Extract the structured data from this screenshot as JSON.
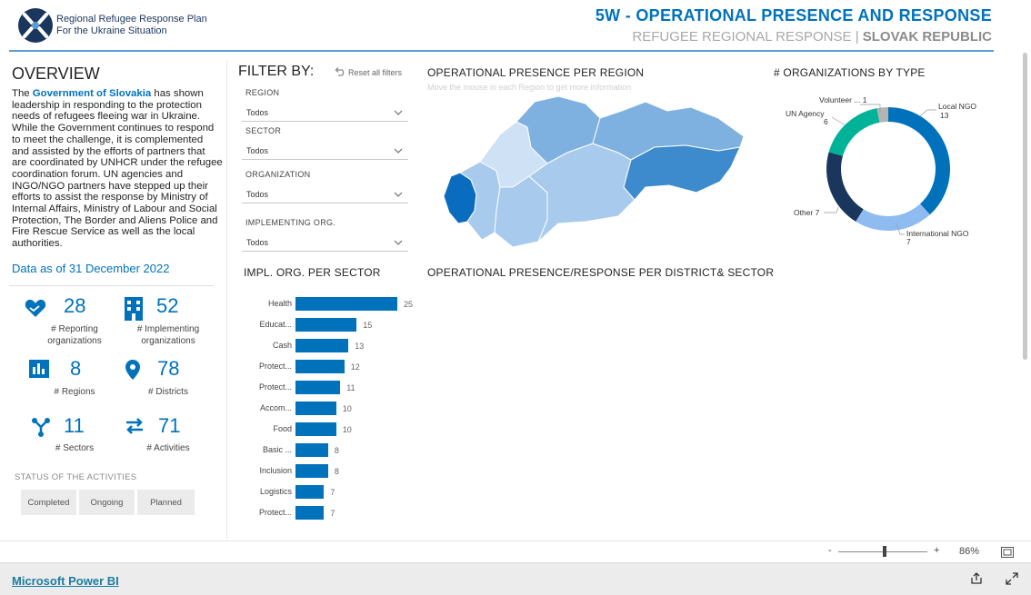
{
  "header": {
    "logo_line1": "Regional Refugee Response Plan",
    "logo_line2": "For the Ukraine Situation",
    "title": "5W - OPERATIONAL PRESENCE AND RESPONSE",
    "subtitle_prefix": "REFUGEE REGIONAL RESPONSE |",
    "subtitle_country": "SLOVAK REPUBLIC"
  },
  "overview": {
    "heading": "OVERVIEW",
    "text_pre": "The ",
    "text_gov": "Government of Slovakia",
    "text_post": " has shown leadership in responding to the protection needs of refugees fleeing war in Ukraine. While the Government continues to respond to meet the challenge, it is complemented and assisted by the efforts of partners that are coordinated by UNHCR under the refugee coordination forum. UN agencies and INGO/NGO partners have stepped up their efforts to assist the response by Ministry of Internal Affairs, Ministry of Labour and Social Protection, The Border and Aliens Police and Fire Rescue Service as well as the local authorities.",
    "data_as_of": "Data as of 31 December 2022"
  },
  "kpis": [
    {
      "value": "28",
      "label": "# Reporting organizations",
      "icon": "handshake-heart-icon"
    },
    {
      "value": "52",
      "label": "# Implementing organizations",
      "icon": "building-icon"
    },
    {
      "value": "8",
      "label": "# Regions",
      "icon": "map-stats-icon"
    },
    {
      "value": "78",
      "label": "# Districts",
      "icon": "map-pin-icon"
    },
    {
      "value": "11",
      "label": "# Sectors",
      "icon": "network-icon"
    },
    {
      "value": "71",
      "label": "# Activities",
      "icon": "exchange-arrows-icon"
    }
  ],
  "status": {
    "heading": "STATUS OF THE ACTIVITIES",
    "buttons": [
      "Completed",
      "Ongoing",
      "Planned"
    ]
  },
  "filters": {
    "heading": "FILTER BY:",
    "reset_label": "Reset all filters",
    "items": [
      {
        "label": "REGION",
        "value": "Todos"
      },
      {
        "label": "SECTOR",
        "value": "Todos"
      },
      {
        "label": "ORGANIZATION",
        "value": "Todos"
      },
      {
        "label": "IMPLEMENTING ORG.",
        "value": "Todos"
      }
    ]
  },
  "map": {
    "title": "OPERATIONAL PRESENCE PER REGION",
    "hint": "Move the mouse in each Region to get more information",
    "colors": [
      "#0a6cbf",
      "#3d8bcc",
      "#7fb1e0",
      "#a7caed",
      "#cfe1f5"
    ]
  },
  "district_title": "OPERATIONAL PRESENCE/RESPONSE PER DISTRICT& SECTOR",
  "chart_data": [
    {
      "type": "bar",
      "title": "IMPL. ORG. PER SECTOR",
      "categories": [
        "Health",
        "Educat...",
        "Cash",
        "Protect...",
        "Protect...",
        "Accom...",
        "Food",
        "Basic ...",
        "Inclusion",
        "Logistics",
        "Protect..."
      ],
      "values": [
        25,
        15,
        13,
        12,
        11,
        10,
        10,
        8,
        8,
        7,
        7
      ],
      "color": "#0072bc"
    },
    {
      "type": "pie",
      "title": "# ORGANIZATIONS BY TYPE",
      "donut": true,
      "slices": [
        {
          "name": "Local NGO",
          "value": 13,
          "color": "#0072bc"
        },
        {
          "name": "International NGO",
          "value": 7,
          "color": "#8ebcf0"
        },
        {
          "name": "Other",
          "value": 7,
          "color": "#1b365d"
        },
        {
          "name": "UN Agency",
          "value": 6,
          "color": "#00b398"
        },
        {
          "name": "Volunteer ...",
          "value": 1,
          "color": "#b4b4b4"
        }
      ]
    }
  ],
  "footer": {
    "zoom_minus": "-",
    "zoom_plus": "+",
    "zoom_value": "86%",
    "zoom_level": 0.86,
    "powerbi_link": "Microsoft Power BI"
  }
}
